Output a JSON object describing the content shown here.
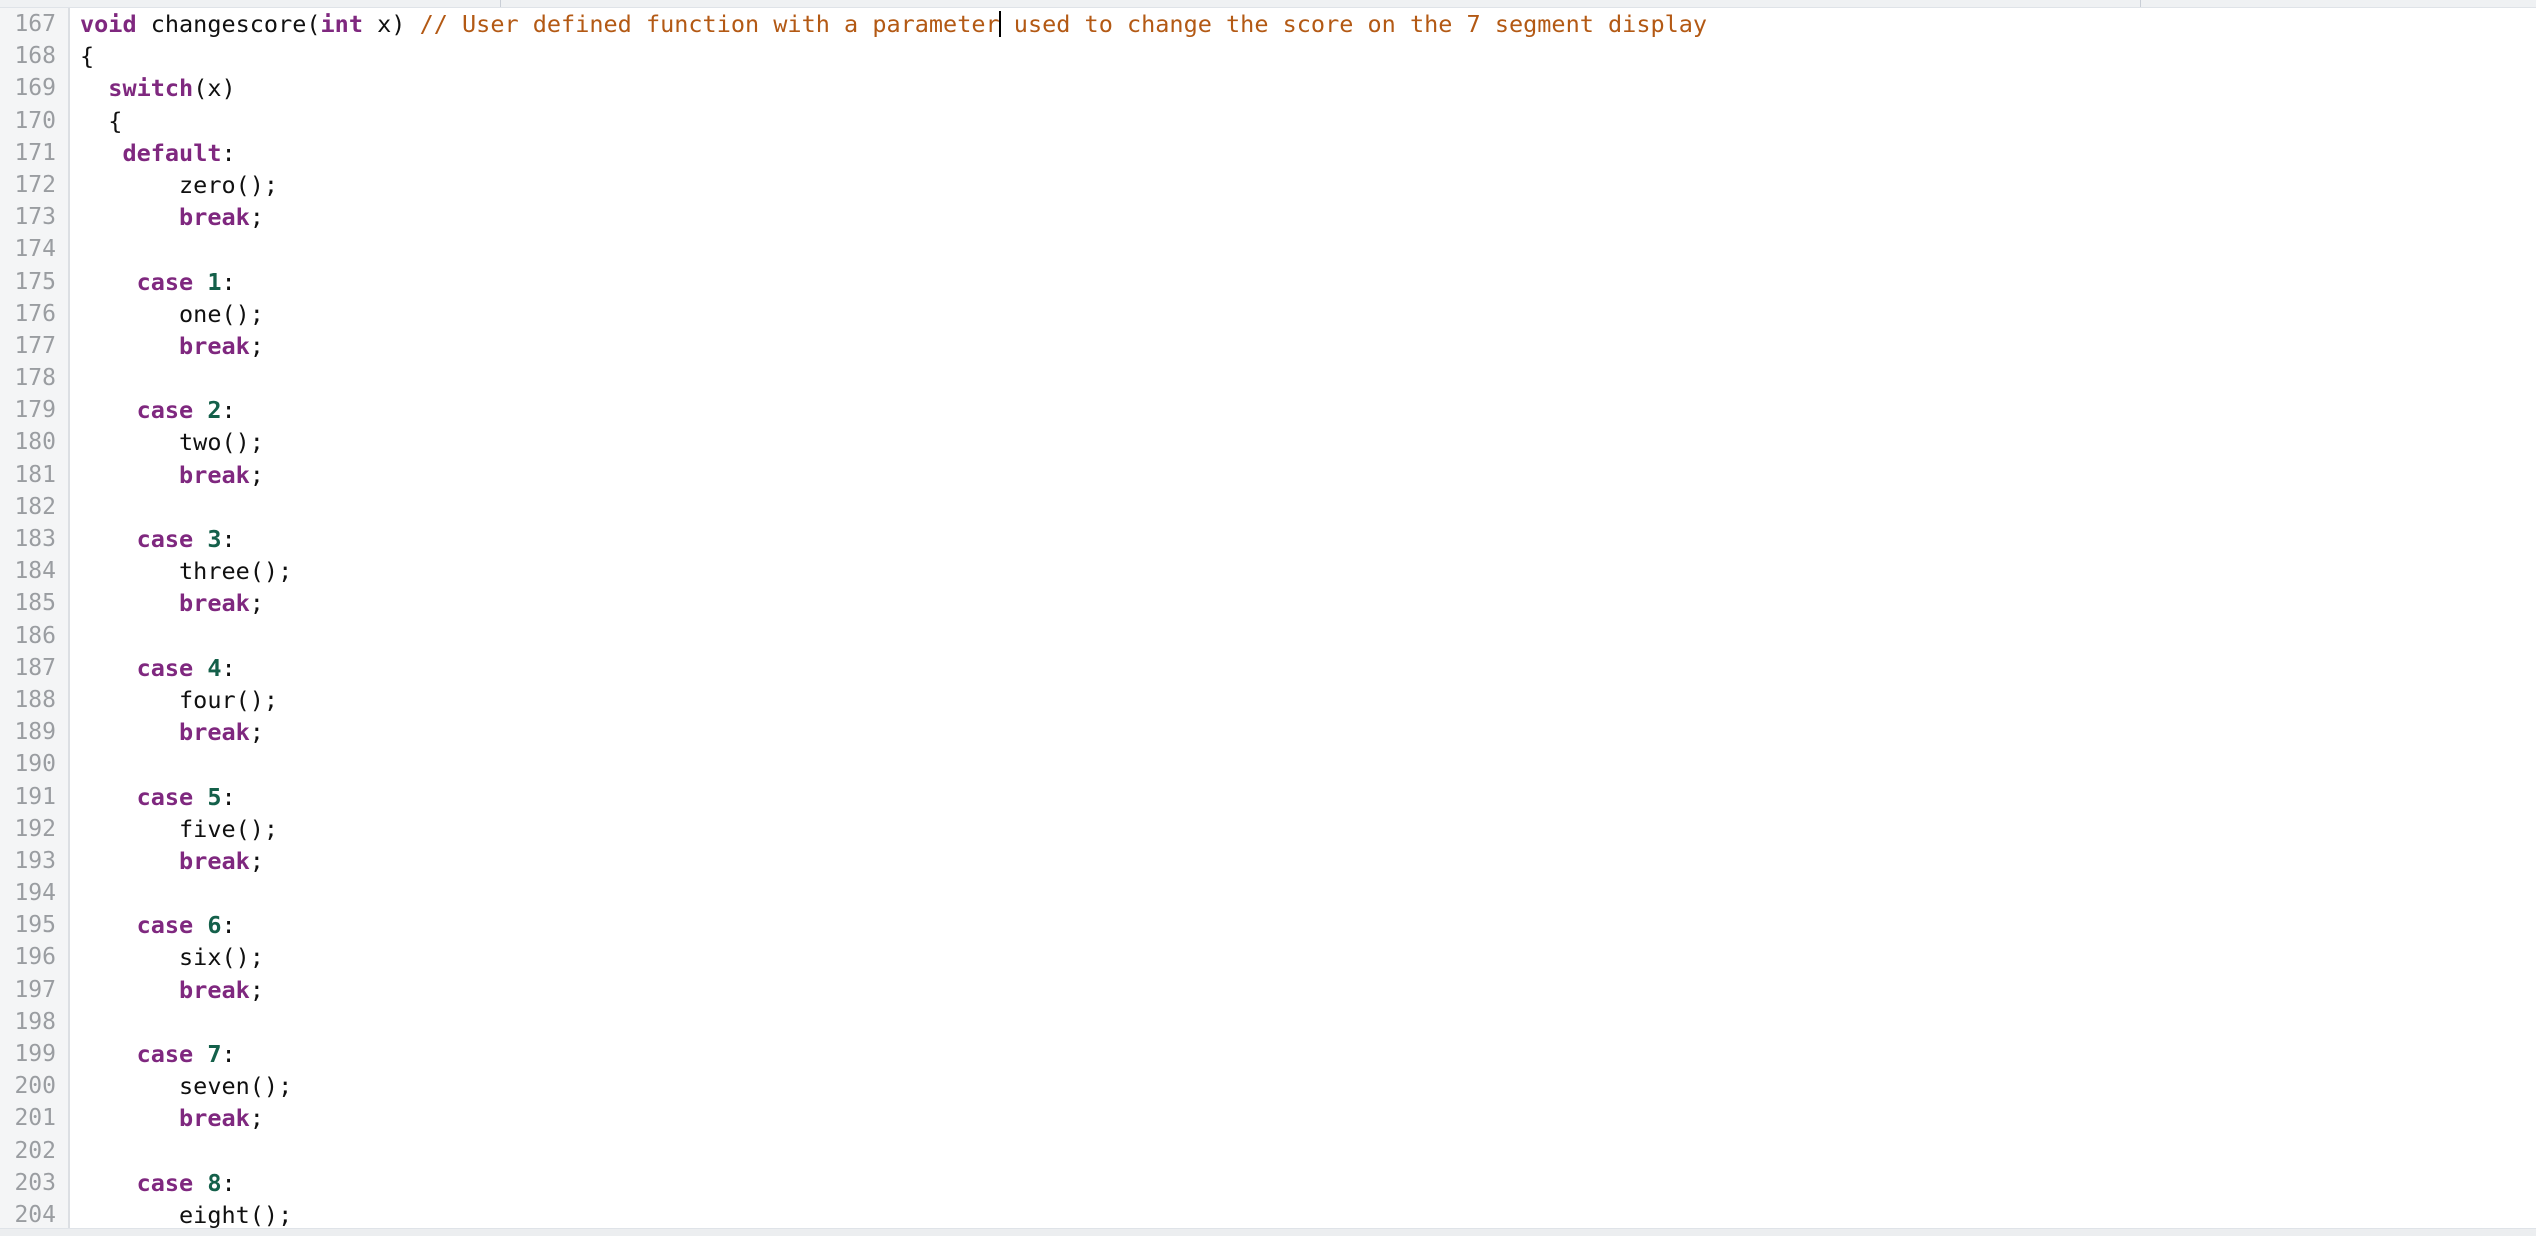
{
  "window": {
    "app": "code-editor",
    "theme_background": "#ffffff",
    "gutter_background": "#f4f5f6",
    "tabstrip_background": "#eff1f3"
  },
  "colors": {
    "keyword": "#7f287f",
    "comment": "#b35914",
    "number": "#14604a",
    "plain": "#101010",
    "line_number": "#9a9da1",
    "caret": "#000000"
  },
  "caret": {
    "line": 167,
    "after_text": "parameter",
    "visible": true
  },
  "editor": {
    "first_visible_line": 167,
    "last_visible_line": 204,
    "language": "cpp",
    "lines": [
      {
        "number": "167",
        "indent": 0,
        "tokens": [
          {
            "t": "void",
            "c": "kw"
          },
          {
            "t": " changescore",
            "c": "pln"
          },
          {
            "t": "(",
            "c": "punc"
          },
          {
            "t": "int",
            "c": "kw"
          },
          {
            "t": " x",
            "c": "pln"
          },
          {
            "t": ") ",
            "c": "punc"
          },
          {
            "t": "// User defined function with a parameter",
            "c": "cmt"
          },
          {
            "t": "",
            "c": "caret"
          },
          {
            "t": " used to change the score on the 7 segment display",
            "c": "cmt"
          }
        ]
      },
      {
        "number": "168",
        "indent": 0,
        "tokens": [
          {
            "t": "{",
            "c": "punc"
          }
        ]
      },
      {
        "number": "169",
        "indent": 0,
        "tokens": [
          {
            "t": "  ",
            "c": "pln"
          },
          {
            "t": "switch",
            "c": "kw"
          },
          {
            "t": "(x)",
            "c": "punc"
          }
        ]
      },
      {
        "number": "170",
        "indent": 0,
        "tokens": [
          {
            "t": "  {",
            "c": "punc"
          }
        ]
      },
      {
        "number": "171",
        "indent": 0,
        "tokens": [
          {
            "t": "   ",
            "c": "pln"
          },
          {
            "t": "default",
            "c": "kw"
          },
          {
            "t": ":",
            "c": "punc"
          }
        ]
      },
      {
        "number": "172",
        "indent": 0,
        "tokens": [
          {
            "t": "       zero",
            "c": "pln"
          },
          {
            "t": "();",
            "c": "punc"
          }
        ]
      },
      {
        "number": "173",
        "indent": 0,
        "tokens": [
          {
            "t": "       ",
            "c": "pln"
          },
          {
            "t": "break",
            "c": "kw"
          },
          {
            "t": ";",
            "c": "punc"
          }
        ]
      },
      {
        "number": "174",
        "indent": 0,
        "tokens": []
      },
      {
        "number": "175",
        "indent": 0,
        "tokens": [
          {
            "t": "    ",
            "c": "pln"
          },
          {
            "t": "case",
            "c": "kw"
          },
          {
            "t": " ",
            "c": "pln"
          },
          {
            "t": "1",
            "c": "num"
          },
          {
            "t": ":",
            "c": "punc"
          }
        ]
      },
      {
        "number": "176",
        "indent": 0,
        "tokens": [
          {
            "t": "       one",
            "c": "pln"
          },
          {
            "t": "();",
            "c": "punc"
          }
        ]
      },
      {
        "number": "177",
        "indent": 0,
        "tokens": [
          {
            "t": "       ",
            "c": "pln"
          },
          {
            "t": "break",
            "c": "kw"
          },
          {
            "t": ";",
            "c": "punc"
          }
        ]
      },
      {
        "number": "178",
        "indent": 0,
        "tokens": []
      },
      {
        "number": "179",
        "indent": 0,
        "tokens": [
          {
            "t": "    ",
            "c": "pln"
          },
          {
            "t": "case",
            "c": "kw"
          },
          {
            "t": " ",
            "c": "pln"
          },
          {
            "t": "2",
            "c": "num"
          },
          {
            "t": ":",
            "c": "punc"
          }
        ]
      },
      {
        "number": "180",
        "indent": 0,
        "tokens": [
          {
            "t": "       two",
            "c": "pln"
          },
          {
            "t": "();",
            "c": "punc"
          }
        ]
      },
      {
        "number": "181",
        "indent": 0,
        "tokens": [
          {
            "t": "       ",
            "c": "pln"
          },
          {
            "t": "break",
            "c": "kw"
          },
          {
            "t": ";",
            "c": "punc"
          }
        ]
      },
      {
        "number": "182",
        "indent": 0,
        "tokens": []
      },
      {
        "number": "183",
        "indent": 0,
        "tokens": [
          {
            "t": "    ",
            "c": "pln"
          },
          {
            "t": "case",
            "c": "kw"
          },
          {
            "t": " ",
            "c": "pln"
          },
          {
            "t": "3",
            "c": "num"
          },
          {
            "t": ":",
            "c": "punc"
          }
        ]
      },
      {
        "number": "184",
        "indent": 0,
        "tokens": [
          {
            "t": "       three",
            "c": "pln"
          },
          {
            "t": "();",
            "c": "punc"
          }
        ]
      },
      {
        "number": "185",
        "indent": 0,
        "tokens": [
          {
            "t": "       ",
            "c": "pln"
          },
          {
            "t": "break",
            "c": "kw"
          },
          {
            "t": ";",
            "c": "punc"
          }
        ]
      },
      {
        "number": "186",
        "indent": 0,
        "tokens": []
      },
      {
        "number": "187",
        "indent": 0,
        "tokens": [
          {
            "t": "    ",
            "c": "pln"
          },
          {
            "t": "case",
            "c": "kw"
          },
          {
            "t": " ",
            "c": "pln"
          },
          {
            "t": "4",
            "c": "num"
          },
          {
            "t": ":",
            "c": "punc"
          }
        ]
      },
      {
        "number": "188",
        "indent": 0,
        "tokens": [
          {
            "t": "       four",
            "c": "pln"
          },
          {
            "t": "();",
            "c": "punc"
          }
        ]
      },
      {
        "number": "189",
        "indent": 0,
        "tokens": [
          {
            "t": "       ",
            "c": "pln"
          },
          {
            "t": "break",
            "c": "kw"
          },
          {
            "t": ";",
            "c": "punc"
          }
        ]
      },
      {
        "number": "190",
        "indent": 0,
        "tokens": []
      },
      {
        "number": "191",
        "indent": 0,
        "tokens": [
          {
            "t": "    ",
            "c": "pln"
          },
          {
            "t": "case",
            "c": "kw"
          },
          {
            "t": " ",
            "c": "pln"
          },
          {
            "t": "5",
            "c": "num"
          },
          {
            "t": ":",
            "c": "punc"
          }
        ]
      },
      {
        "number": "192",
        "indent": 0,
        "tokens": [
          {
            "t": "       five",
            "c": "pln"
          },
          {
            "t": "();",
            "c": "punc"
          }
        ]
      },
      {
        "number": "193",
        "indent": 0,
        "tokens": [
          {
            "t": "       ",
            "c": "pln"
          },
          {
            "t": "break",
            "c": "kw"
          },
          {
            "t": ";",
            "c": "punc"
          }
        ]
      },
      {
        "number": "194",
        "indent": 0,
        "tokens": []
      },
      {
        "number": "195",
        "indent": 0,
        "tokens": [
          {
            "t": "    ",
            "c": "pln"
          },
          {
            "t": "case",
            "c": "kw"
          },
          {
            "t": " ",
            "c": "pln"
          },
          {
            "t": "6",
            "c": "num"
          },
          {
            "t": ":",
            "c": "punc"
          }
        ]
      },
      {
        "number": "196",
        "indent": 0,
        "tokens": [
          {
            "t": "       six",
            "c": "pln"
          },
          {
            "t": "();",
            "c": "punc"
          }
        ]
      },
      {
        "number": "197",
        "indent": 0,
        "tokens": [
          {
            "t": "       ",
            "c": "pln"
          },
          {
            "t": "break",
            "c": "kw"
          },
          {
            "t": ";",
            "c": "punc"
          }
        ]
      },
      {
        "number": "198",
        "indent": 0,
        "tokens": []
      },
      {
        "number": "199",
        "indent": 0,
        "tokens": [
          {
            "t": "    ",
            "c": "pln"
          },
          {
            "t": "case",
            "c": "kw"
          },
          {
            "t": " ",
            "c": "pln"
          },
          {
            "t": "7",
            "c": "num"
          },
          {
            "t": ":",
            "c": "punc"
          }
        ]
      },
      {
        "number": "200",
        "indent": 0,
        "tokens": [
          {
            "t": "       seven",
            "c": "pln"
          },
          {
            "t": "();",
            "c": "punc"
          }
        ]
      },
      {
        "number": "201",
        "indent": 0,
        "tokens": [
          {
            "t": "       ",
            "c": "pln"
          },
          {
            "t": "break",
            "c": "kw"
          },
          {
            "t": ";",
            "c": "punc"
          }
        ]
      },
      {
        "number": "202",
        "indent": 0,
        "tokens": []
      },
      {
        "number": "203",
        "indent": 0,
        "tokens": [
          {
            "t": "    ",
            "c": "pln"
          },
          {
            "t": "case",
            "c": "kw"
          },
          {
            "t": " ",
            "c": "pln"
          },
          {
            "t": "8",
            "c": "num"
          },
          {
            "t": ":",
            "c": "punc"
          }
        ]
      },
      {
        "number": "204",
        "indent": 0,
        "tokens": [
          {
            "t": "       eight",
            "c": "pln"
          },
          {
            "t": "();",
            "c": "punc"
          }
        ]
      }
    ]
  }
}
